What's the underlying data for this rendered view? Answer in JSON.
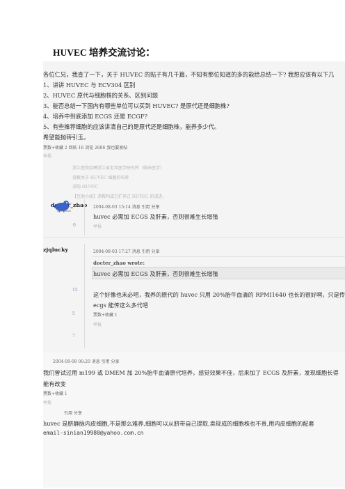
{
  "title": "HUVEC 培养交流讨论：",
  "intro": {
    "lines": [
      "各位仁兄，我查了一下，关于 HUVEC 的贴子有几千篇，不知有那位知道的多的能给总结一下? 我想应该有以下几",
      "1、讲讲 HUVEC 与 ECV304 区别",
      "2、HUVEC 原代与细胞株的关系、区别问题",
      "3、能否总结一下国内有哪些单位可以买到 HUVEC? 是原代还是细胞株?",
      "4、培养中到底添加 ECGS 还是 ECGF?",
      "5、有些推荐细胞的应该讲清自己的是原代还是细胞株，能养多少代。",
      "希望能抛砖引玉。"
    ],
    "meta": "票数+收藏 2 回帖 16 浏览 2686 我也要发帖",
    "report": "举报"
  },
  "related": [
    "浙江医院招聘浙江省老年医学研究所（临床医学）",
    "请教关于 HUVEC 细胞的培养",
    "求购 HUVEC",
    "【互助小组】求教构成已扩养过 HUVEC 的请进，"
  ],
  "posts": [
    {
      "user": "docter_zhao",
      "count": "0",
      "meta": "2004-08-03 15:14 消息 引用 分享",
      "text": "huvec 必需加 ECGS 及肝素，否则很难生长增殖",
      "report": "举报"
    },
    {
      "user": "zjqlucky",
      "counts": [
        "15",
        "5",
        "7"
      ],
      "meta": "2004-08-03 17:27 消息 引用 分享",
      "quote_author": "docter_zhao wrote:",
      "quote_text": "huvec 必需加 ECGS 及肝素，否则很难生长增殖",
      "text_lines": [
        "这个好像也未必吧，我养的原代的 huvec 只用 20%胎牛血清的 RPMI1640 也长的很好啊，只是传",
        "ecgs 能传这么多代吧"
      ],
      "votes": "票数+收藏 1",
      "report": "举报"
    },
    {
      "meta": "2004-09-08 00:20 消息 引用 分享",
      "text_lines": [
        "我们曾试过用 m199 或 DMEM 加 20%胎牛血清原代培养，感觉效果不佳，后来加了 ECGS 及肝素，发现细胞长得",
        "能有改变"
      ],
      "votes": "票数+收藏 1",
      "report": "举报"
    },
    {
      "meta": "引用 分享",
      "text_lines": [
        "huvec 是脐静脉内皮细胞,不是那么难养,细胞可以从脐带自己提取,卖现成的细胞株也不贵,用内皮细胞的配套",
        "email-sinian19980@yahoo.com.cn"
      ]
    }
  ]
}
